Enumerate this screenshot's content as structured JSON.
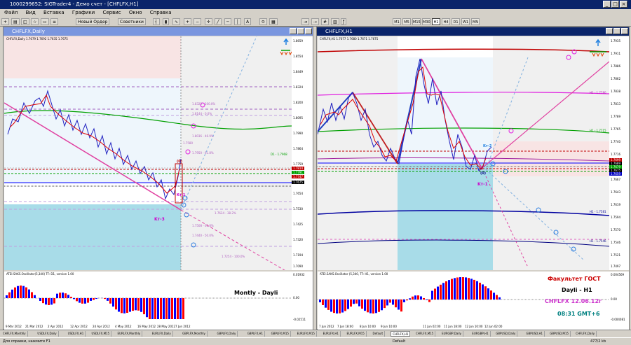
{
  "app": {
    "title": "1000299652: SIGTrader4 - Демо счет - [CHFLFX,H1]"
  },
  "menu": [
    "Файл",
    "Вид",
    "Вставка",
    "Графики",
    "Сервис",
    "Окно",
    "Справка"
  ],
  "toolbar": {
    "new_order": "Новый Ордер",
    "advisors": "Советники",
    "timeframes": [
      "M1",
      "M5",
      "M15",
      "M30",
      "H1",
      "H4",
      "D1",
      "W1",
      "MN"
    ],
    "selected_tf": "H1"
  },
  "left_window": {
    "title": "CHFLFX,Daily",
    "info": "CHFLFX,Daily  1.7679 1.7692 1.7635 1.7675",
    "price_ticks": [
      "1.8659",
      "1.8554",
      "1.8449",
      "1.8324",
      "1.8200",
      "1.8095",
      "1.7990",
      "1.7864",
      "1.7759",
      "1.7654",
      "1.7530",
      "1.7425",
      "1.7320",
      "1.7194",
      "1.7090"
    ],
    "last_price": "1.7675",
    "right_labels": [
      "1.7814",
      "1.7791",
      "1.7747",
      "1.7675"
    ],
    "dates": [
      "9 Mar 2012",
      "21 Mar 2012",
      "2 Apr 2012",
      "12 Apr 2012",
      "24 Apr 2012",
      "4 May 2012",
      "16 May 2012",
      "28 May 2012",
      "7 Jun 2012"
    ],
    "indicator": "ATEI.SAKS.Oscillator(5,340) TF: D1, version 1.00",
    "ind_ticks": [
      "0.01932",
      "0.00",
      "-0.02511"
    ],
    "label_kt3": "Kт-3",
    "label_kt1": "Kт-1",
    "label_zero": "(0)",
    "watermark": "Montly - Dayli",
    "fib_labels": [
      "1.8323 - 100.0%",
      "1.8144 - 0.0%",
      "1.8036 - 46.9%",
      "1.7950 - 61.8%",
      "1.7580",
      "1.7634 - 38.2%",
      "1.7508 - 61.8%",
      "1.7440 - 50.0%",
      "1.7254 - 100.0%",
      "D1 - 1.7968"
    ]
  },
  "right_window": {
    "title": "CHFLFX,H1",
    "info": "CHFLFX,H1  1.7677 1.7680 1.7671 1.7675",
    "price_ticks": [
      "1.7935",
      "1.7911",
      "1.7886",
      "1.7862",
      "1.7838",
      "1.7813",
      "1.7789",
      "1.7765",
      "1.7740",
      "1.7716",
      "1.7692",
      "1.7667",
      "1.7643",
      "1.7619",
      "1.7594",
      "1.7570",
      "1.7546",
      "1.7521",
      "1.7497"
    ],
    "last_price": "1.7675",
    "right_labels": [
      "1.7699",
      "1.7689",
      "1.7679",
      "1.7675",
      "1.7659"
    ],
    "dates": [
      "7 Jun 2012",
      "7 Jun 18:00",
      "8 Jun 10:00",
      "9 Jun 10:00",
      "11 Jun 02:00",
      "11 Jun 18:00",
      "12 Jun 10:00",
      "12 Jun 02:00"
    ],
    "indicator": "ATEI.SAKS.Oscillator (5,340, TF: H1, version 1.00",
    "ind_ticks": [
      "0.004569",
      "0.00",
      "-0.004081"
    ],
    "label_kt1": "Kт-1",
    "label_kt2": "Kт-2",
    "label_zero": "(0)",
    "hline_labels": [
      "H1 - 1.7780",
      "H1 - 1.7715",
      "H1 - 1.7581",
      "H1 - 1.7546"
    ],
    "brand": {
      "line1": "Факультет ГОСТ",
      "line2": "Dayli - H1",
      "line3": "CHFLFX 12.06.12г",
      "line4": "08:31 GMT+6"
    }
  },
  "tabs": [
    "CHFLFX,Monthly",
    "USDLFX,Daily",
    "USDLFX,H1",
    "USDLFX,M15",
    "EURLFX,Monthly",
    "EURLFX,Daily",
    "GBPLFX,Monthly",
    "GBPLFX,Daily",
    "GBPLFX,H1",
    "GBPLFX,M15",
    "EURLFX,M15",
    "EURLFX,H1",
    "EURLFX,M15",
    "Default",
    "CHFLFX,H1",
    "CHFLFX,M15",
    "EURGBP,Daily",
    "EURGBP,H1",
    "GBPUSD,Daily",
    "GBPUSD,H1",
    "GBPUSD,M15",
    "CHFLFX,Daily"
  ],
  "active_tab": "CHFLFX,H1",
  "status": {
    "help": "Для справки, нажмите F1",
    "profile": "Default",
    "traffic": "477/2 kb"
  },
  "colors": {
    "accent": "#0a246a",
    "candle_up": "#0000ff",
    "candle_down": "#ff0000",
    "ma_green": "#00a000",
    "trend": "#e040a0",
    "label": "#cc00cc"
  }
}
